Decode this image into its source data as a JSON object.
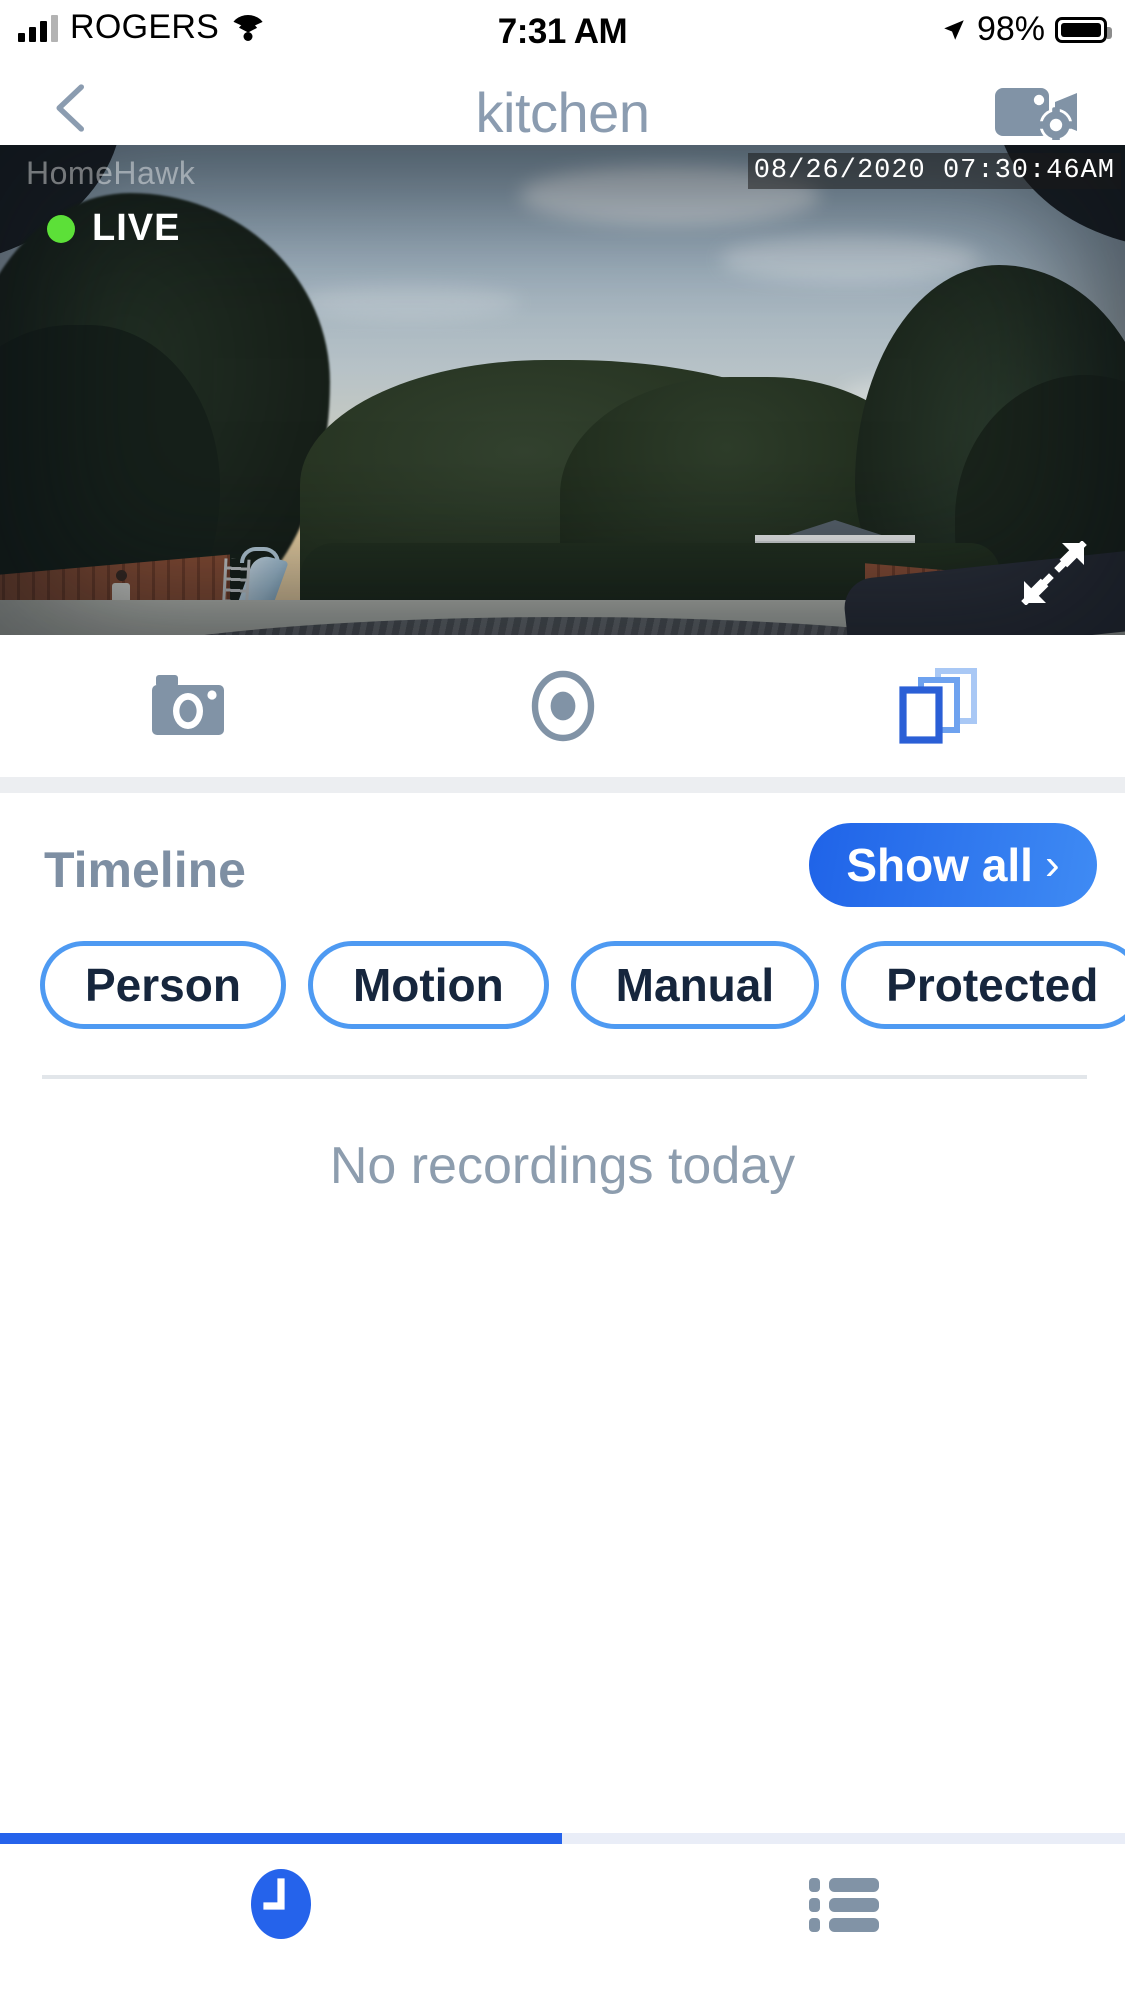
{
  "status_bar": {
    "carrier": "ROGERS",
    "time": "7:31 AM",
    "battery_percent": "98%",
    "signal_icon": "signal-bars-icon",
    "wifi_icon": "wifi-icon",
    "location_icon": "location-arrow-icon",
    "battery_icon": "battery-full-icon"
  },
  "navbar": {
    "back_icon": "chevron-left-icon",
    "title": "kitchen",
    "settings_icon": "camera-settings-icon",
    "title_color": "#8b9cb0"
  },
  "video": {
    "watermark": "HomeHawk",
    "timestamp": "08/26/2020  07:30:46AM",
    "live_label": "LIVE",
    "live_dot_color": "#5ce038",
    "expand_icon": "fullscreen-expand-icon",
    "scene_description": "backyard swimming pool covered with tarp, blue slide, hedge, shed and houses at dawn"
  },
  "controls": [
    {
      "name": "snapshot",
      "icon": "camera-photo-icon",
      "color": "#8193a6"
    },
    {
      "name": "record",
      "icon": "record-circle-icon",
      "color": "#8193a6"
    },
    {
      "name": "multiview",
      "icon": "layers-stack-icon",
      "color": "#2a5fd6"
    }
  ],
  "timeline": {
    "title": "Timeline",
    "show_all_label": "Show all",
    "show_all_chevron": "›",
    "show_all_color": "#2563eb",
    "filters": [
      {
        "label": "Person"
      },
      {
        "label": "Motion"
      },
      {
        "label": "Manual"
      },
      {
        "label": "Protected"
      }
    ],
    "chip_border_color": "#4e9af2",
    "empty_state": "No recordings today"
  },
  "tabbar": {
    "items": [
      {
        "name": "timeline-tab",
        "icon": "clock-icon",
        "active": true
      },
      {
        "name": "list-tab",
        "icon": "list-icon",
        "active": false
      }
    ],
    "active_color": "#2563eb",
    "inactive_color": "#8193a6"
  }
}
